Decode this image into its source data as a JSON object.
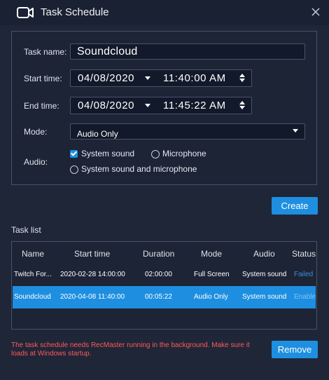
{
  "window": {
    "title": "Task Schedule"
  },
  "form": {
    "task_name_label": "Task name:",
    "task_name_value": "Soundcloud",
    "start_label": "Start time:",
    "start_date": "04/08/2020",
    "start_time": "11:40:00  AM",
    "end_label": "End time:",
    "end_date": "04/08/2020",
    "end_time": "11:45:22  AM",
    "mode_label": "Mode:",
    "mode_value": "Audio Only",
    "audio_label": "Audio:",
    "audio_options": [
      "System sound",
      "Microphone",
      "System sound and microphone"
    ],
    "audio_selected": "System sound"
  },
  "create_button": "Create",
  "task_list": {
    "title": "Task list",
    "columns": [
      "Name",
      "Start time",
      "Duration",
      "Mode",
      "Audio",
      "Status"
    ],
    "rows": [
      {
        "name": "Twitch For...",
        "start": "2020-02-28 14:00:00",
        "duration": "02:00:00",
        "mode": "Full Screen",
        "audio": "System sound",
        "status": "Failed",
        "selected": false
      },
      {
        "name": "Soundcloud",
        "start": "2020-04-08 11:40:00",
        "duration": "00:05:22",
        "mode": "Audio Only",
        "audio": "System sound",
        "status": "Enable",
        "selected": true
      }
    ]
  },
  "footer": {
    "note": "The task schedule needs RecMaster running in the background. Make sure it loads at Windows startup.",
    "remove_button": "Remove"
  },
  "colors": {
    "background": "#1f2638",
    "accent": "#1e8fe0",
    "warning": "#ff5a5a"
  }
}
